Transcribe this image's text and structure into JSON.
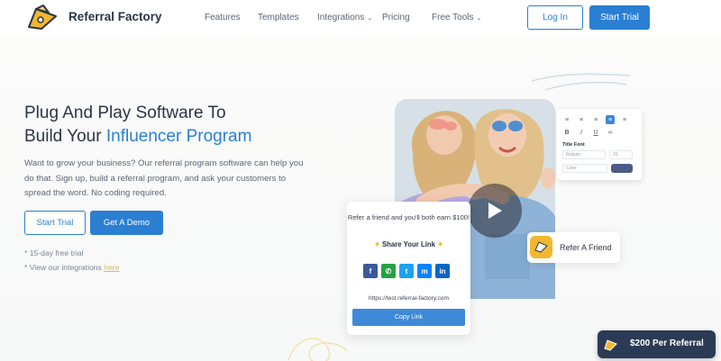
{
  "nav": {
    "brand": "Referral Factory",
    "links": [
      "Features",
      "Templates",
      "Integrations",
      "Pricing",
      "Free Tools"
    ],
    "login": "Log In",
    "start_trial": "Start Trial"
  },
  "hero": {
    "headline_line1": "Plug And Play Software To",
    "headline_line2_prefix": "Build Your",
    "headline_accent": "Influencer Program",
    "description": "Want to grow your business? Our referral program software can help you do that. Sign up, build a referral program, and ask your customers to spread the word. No coding required.",
    "start_trial": "Start Trial",
    "get_demo": "Get A Demo",
    "note1": "* 15-day free trial",
    "note2_prefix": "* View our integrations",
    "note2_link": "here"
  },
  "editor": {
    "title_font": "Title Font",
    "font_value": "Roboto",
    "size_value": "20",
    "color_label": "Color",
    "swatch_color": "#4b5b86"
  },
  "share_card": {
    "message": "Refer a friend and you'll both earn $100!",
    "heading": "Share Your Link",
    "url": "https://test.referral-factory.com",
    "copy_button": "Copy Link",
    "social_icons": [
      "facebook-icon",
      "whatsapp-icon",
      "twitter-icon",
      "messenger-icon",
      "linkedin-icon"
    ]
  },
  "refer_card": {
    "label": "Refer A Friend"
  },
  "promo": {
    "label": "$200 Per Referral"
  },
  "colors": {
    "primary": "#2b7fd3",
    "dark": "#2b3445",
    "promo_bg": "#2b3a55",
    "gold": "#f3b72f"
  }
}
